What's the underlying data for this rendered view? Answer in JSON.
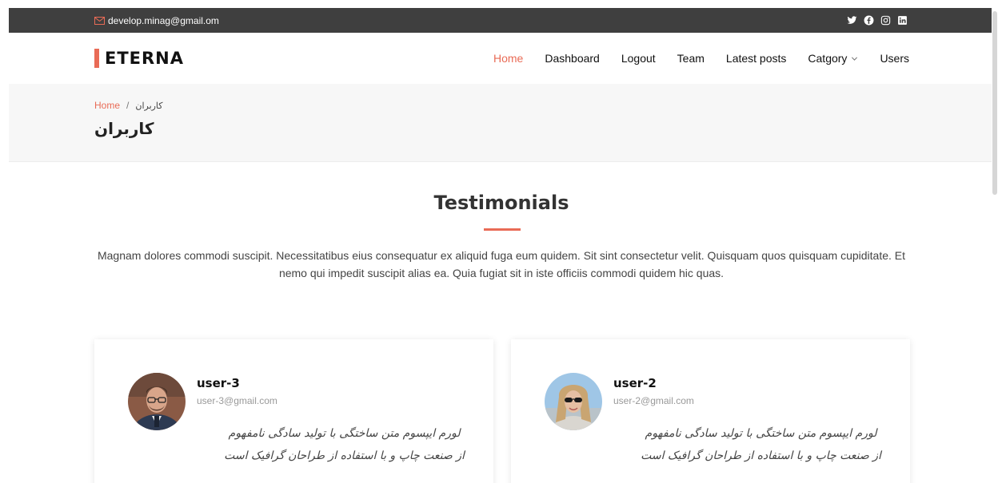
{
  "topbar": {
    "email": "develop.minag@gmail.om",
    "social": [
      "twitter-icon",
      "facebook-icon",
      "instagram-icon",
      "linkedin-icon"
    ]
  },
  "header": {
    "logo": "ETERNA",
    "nav": [
      {
        "label": "Home",
        "active": true
      },
      {
        "label": "Dashboard"
      },
      {
        "label": "Logout"
      },
      {
        "label": "Team"
      },
      {
        "label": "Latest posts"
      },
      {
        "label": "Catgory",
        "dropdown": true
      },
      {
        "label": "Users"
      }
    ]
  },
  "breadcrumbs": {
    "home": "Home",
    "separator": "/",
    "current": "کاربران",
    "title": "کاربران"
  },
  "testimonials": {
    "title": "Testimonials",
    "description": "Magnam dolores commodi suscipit. Necessitatibus eius consequatur ex aliquid fuga eum quidem. Sit sint consectetur velit. Quisquam quos quisquam cupiditate. Et nemo qui impedit suscipit alias ea. Quia fugiat sit in iste officiis commodi quidem hic quas.",
    "cards": [
      {
        "name": "user-3",
        "email": "user-3@gmail.com",
        "quote_line1": "لورم ایپسوم متن ساختگی با تولید سادگی نامفهوم",
        "quote_line2": "از صنعت چاپ و با استفاده از طراحان گرافیک است"
      },
      {
        "name": "user-2",
        "email": "user-2@gmail.com",
        "quote_line1": "لورم ایپسوم متن ساختگی با تولید سادگی نامفهوم",
        "quote_line2": "از صنعت چاپ و با استفاده از طراحان گرافیک است"
      }
    ]
  },
  "colors": {
    "accent": "#e96b56",
    "topbar": "#3f3f3f",
    "breadcrumb_bg": "#f7f7f7"
  }
}
